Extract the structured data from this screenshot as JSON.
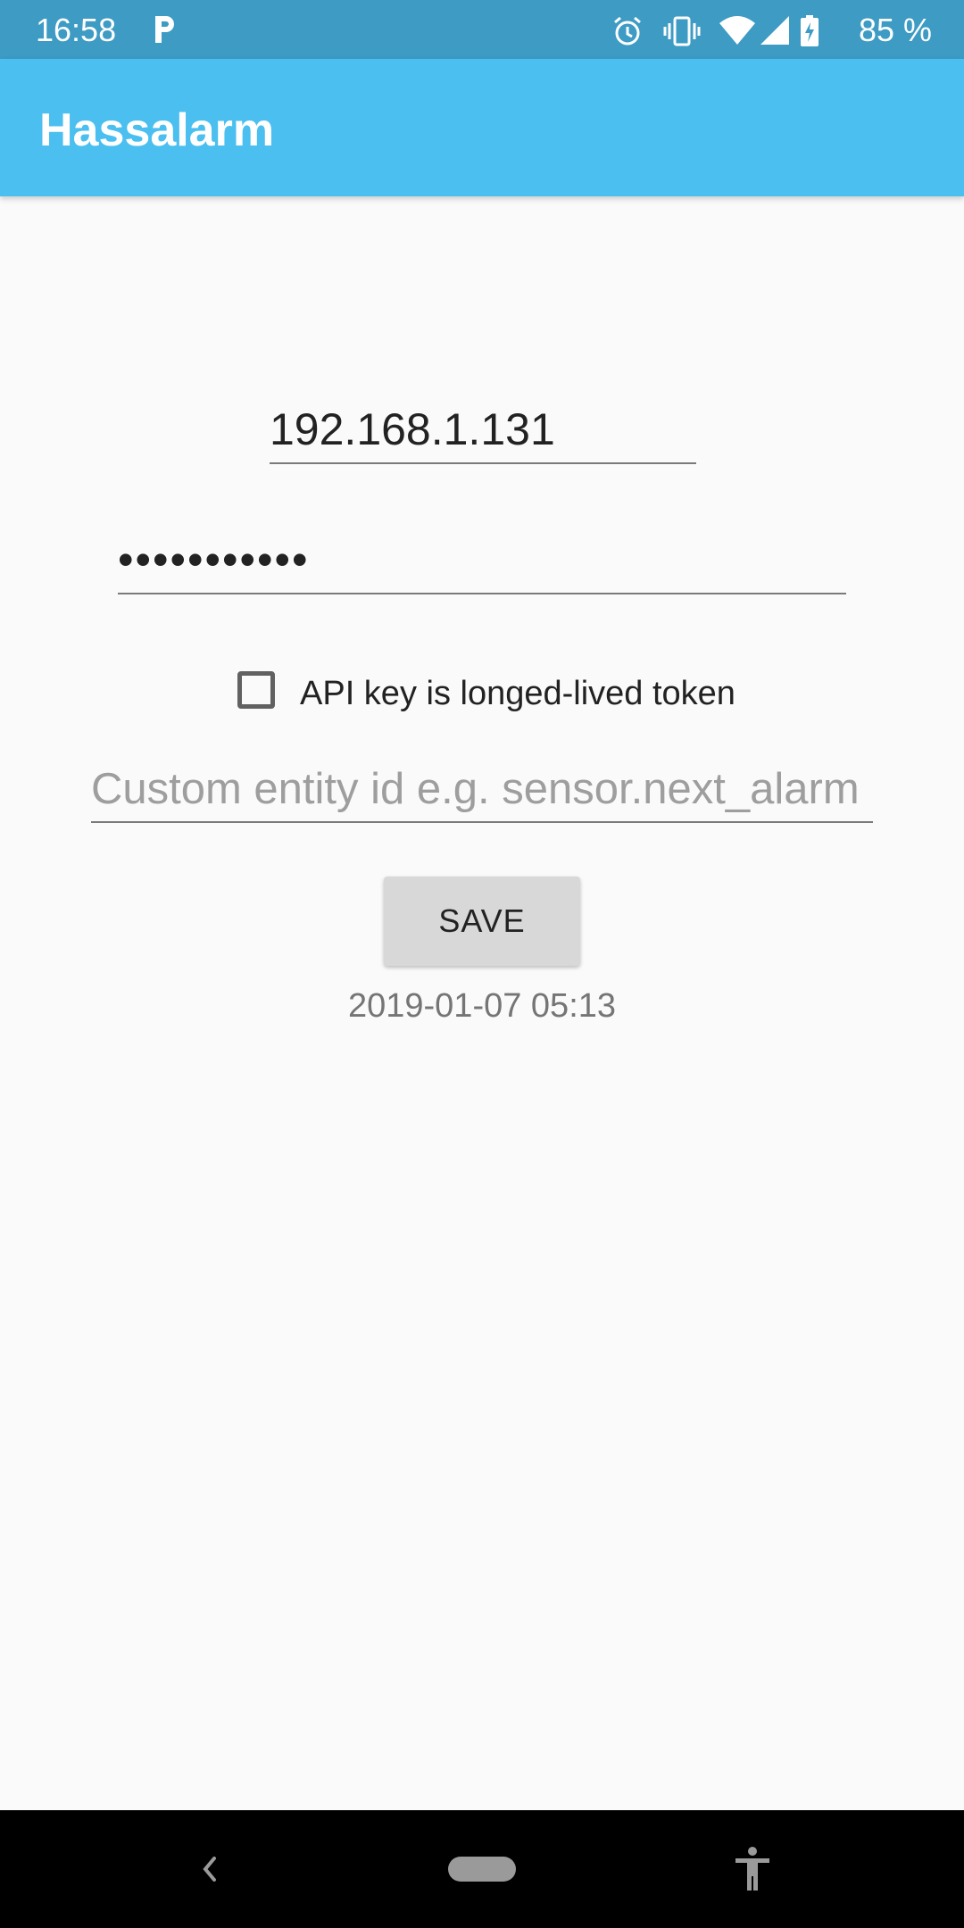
{
  "status_bar": {
    "time": "16:58",
    "battery": "85 %",
    "icons": [
      "p-app-icon",
      "alarm-icon",
      "vibrate-icon",
      "wifi-icon",
      "signal-icon",
      "battery-charging-icon"
    ]
  },
  "app_bar": {
    "title": "Hassalarm"
  },
  "form": {
    "host_value": "192.168.1.131",
    "api_key_value": "•••••••••••",
    "checkbox_label": "API key is longed-lived token",
    "checkbox_checked": false,
    "entity_placeholder": "Custom entity id e.g. sensor.next_alarm",
    "save_label": "SAVE",
    "timestamp": "2019-01-07 05:13"
  },
  "nav_bar": {
    "icons": [
      "back-icon",
      "home-pill-icon",
      "accessibility-icon"
    ]
  },
  "colors": {
    "status_bar": "#3d9bc4",
    "app_bar": "#4bbfef",
    "background": "#fafafa",
    "button": "#d8d8d8"
  }
}
